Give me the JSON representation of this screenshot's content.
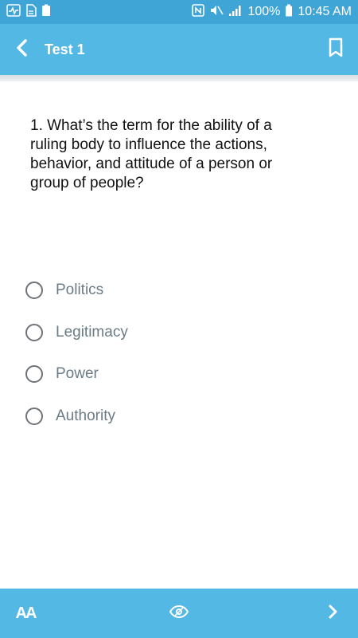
{
  "status_bar": {
    "battery_percent": "100%",
    "time": "10:45 AM",
    "icons": [
      "pulse-icon",
      "doc-icon",
      "battery-small-icon",
      "nfc-icon",
      "mute-icon",
      "signal-icon",
      "battery-icon"
    ]
  },
  "header": {
    "title": "Test 1",
    "back_icon": "chevron-left-icon",
    "bookmark_icon": "bookmark-icon"
  },
  "question": {
    "text": "1. What’s the term for the ability of a ruling body to influence the actions, behavior, and attitude of a person or group of people?"
  },
  "options": [
    {
      "label": "Politics"
    },
    {
      "label": "Legitimacy"
    },
    {
      "label": "Power"
    },
    {
      "label": "Authority"
    }
  ],
  "bottom_bar": {
    "font_size_label": "AA",
    "eye_icon": "eye-icon",
    "next_icon": "chevron-right-icon"
  },
  "colors": {
    "status_bar": "#3fa5d6",
    "app_bar": "#53b8e4",
    "question_text": "#111111",
    "option_text": "#6b7b85"
  }
}
